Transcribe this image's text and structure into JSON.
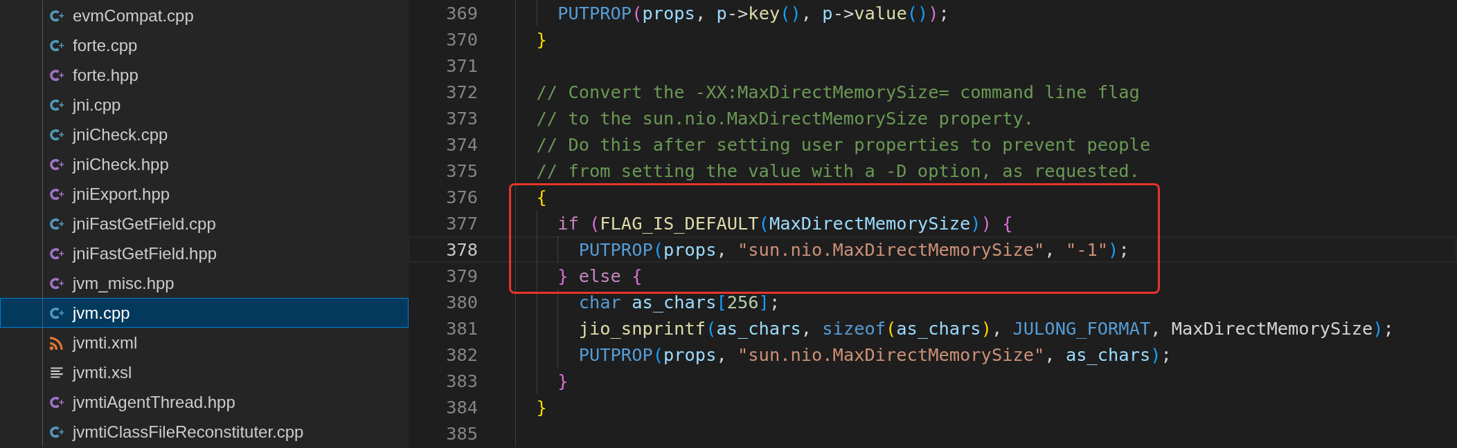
{
  "sidebar": {
    "files": [
      {
        "name": "evmCompat.cpp",
        "kind": "cpp",
        "selected": false
      },
      {
        "name": "forte.cpp",
        "kind": "cpp",
        "selected": false
      },
      {
        "name": "forte.hpp",
        "kind": "hpp",
        "selected": false
      },
      {
        "name": "jni.cpp",
        "kind": "cpp",
        "selected": false
      },
      {
        "name": "jniCheck.cpp",
        "kind": "cpp",
        "selected": false
      },
      {
        "name": "jniCheck.hpp",
        "kind": "hpp",
        "selected": false
      },
      {
        "name": "jniExport.hpp",
        "kind": "hpp",
        "selected": false
      },
      {
        "name": "jniFastGetField.cpp",
        "kind": "cpp",
        "selected": false
      },
      {
        "name": "jniFastGetField.hpp",
        "kind": "hpp",
        "selected": false
      },
      {
        "name": "jvm_misc.hpp",
        "kind": "hpp",
        "selected": false
      },
      {
        "name": "jvm.cpp",
        "kind": "cpp",
        "selected": true
      },
      {
        "name": "jvmti.xml",
        "kind": "xml",
        "selected": false
      },
      {
        "name": "jvmti.xsl",
        "kind": "text",
        "selected": false
      },
      {
        "name": "jvmtiAgentThread.hpp",
        "kind": "hpp",
        "selected": false
      },
      {
        "name": "jvmtiClassFileReconstituter.cpp",
        "kind": "cpp",
        "selected": false
      }
    ]
  },
  "editor": {
    "lines": [
      {
        "number": "369",
        "current": false,
        "tokens": [
          {
            "kind": "macro",
            "text": "    PUTPROP"
          },
          {
            "kind": "bracket2",
            "text": "("
          },
          {
            "kind": "var",
            "text": "props"
          },
          {
            "kind": "plain",
            "text": ", "
          },
          {
            "kind": "var",
            "text": "p"
          },
          {
            "kind": "plain",
            "text": "->"
          },
          {
            "kind": "func",
            "text": "key"
          },
          {
            "kind": "bracket3",
            "text": "()"
          },
          {
            "kind": "plain",
            "text": ", "
          },
          {
            "kind": "var",
            "text": "p"
          },
          {
            "kind": "plain",
            "text": "->"
          },
          {
            "kind": "func",
            "text": "value"
          },
          {
            "kind": "bracket3",
            "text": "()"
          },
          {
            "kind": "bracket2",
            "text": ")"
          },
          {
            "kind": "plain",
            "text": ";"
          }
        ]
      },
      {
        "number": "370",
        "current": false,
        "tokens": [
          {
            "kind": "bracket1",
            "text": "  }"
          }
        ]
      },
      {
        "number": "371",
        "current": false
      },
      {
        "number": "372",
        "current": false,
        "tokens": [
          {
            "kind": "comment",
            "text": "  // Convert the -XX:MaxDirectMemorySize= command line flag"
          }
        ]
      },
      {
        "number": "373",
        "current": false,
        "tokens": [
          {
            "kind": "comment",
            "text": "  // to the sun.nio.MaxDirectMemorySize property."
          }
        ]
      },
      {
        "number": "374",
        "current": false,
        "tokens": [
          {
            "kind": "comment",
            "text": "  // Do this after setting user properties to prevent people"
          }
        ]
      },
      {
        "number": "375",
        "current": false,
        "tokens": [
          {
            "kind": "comment",
            "text": "  // from setting the value with a -D option, as requested."
          }
        ]
      },
      {
        "number": "376",
        "current": false,
        "tokens": [
          {
            "kind": "bracket1",
            "text": "  {"
          }
        ]
      },
      {
        "number": "377",
        "current": false,
        "tokens": [
          {
            "kind": "keyword",
            "text": "    if "
          },
          {
            "kind": "bracket2",
            "text": "("
          },
          {
            "kind": "func",
            "text": "FLAG_IS_DEFAULT"
          },
          {
            "kind": "bracket3",
            "text": "("
          },
          {
            "kind": "var",
            "text": "MaxDirectMemorySize"
          },
          {
            "kind": "bracket3",
            "text": ")"
          },
          {
            "kind": "bracket2",
            "text": ") {"
          }
        ]
      },
      {
        "number": "378",
        "current": true,
        "tokens": [
          {
            "kind": "macro",
            "text": "      PUTPROP"
          },
          {
            "kind": "bracket3",
            "text": "("
          },
          {
            "kind": "var",
            "text": "props"
          },
          {
            "kind": "plain",
            "text": ", "
          },
          {
            "kind": "string",
            "text": "\"sun.nio.MaxDirectMemorySize\""
          },
          {
            "kind": "plain",
            "text": ", "
          },
          {
            "kind": "string",
            "text": "\"-1\""
          },
          {
            "kind": "bracket3",
            "text": ")"
          },
          {
            "kind": "plain",
            "text": ";"
          }
        ]
      },
      {
        "number": "379",
        "current": false,
        "tokens": [
          {
            "kind": "bracket2",
            "text": "    } "
          },
          {
            "kind": "keyword",
            "text": "else "
          },
          {
            "kind": "bracket2",
            "text": "{"
          }
        ]
      },
      {
        "number": "380",
        "current": false,
        "tokens": [
          {
            "kind": "type",
            "text": "      char "
          },
          {
            "kind": "var",
            "text": "as_chars"
          },
          {
            "kind": "bracket3",
            "text": "["
          },
          {
            "kind": "number",
            "text": "256"
          },
          {
            "kind": "bracket3",
            "text": "]"
          },
          {
            "kind": "plain",
            "text": ";"
          }
        ]
      },
      {
        "number": "381",
        "current": false,
        "tokens": [
          {
            "kind": "func",
            "text": "      jio_snprintf"
          },
          {
            "kind": "bracket3",
            "text": "("
          },
          {
            "kind": "var",
            "text": "as_chars"
          },
          {
            "kind": "plain",
            "text": ", "
          },
          {
            "kind": "type",
            "text": "sizeof"
          },
          {
            "kind": "bracket1",
            "text": "("
          },
          {
            "kind": "var",
            "text": "as_chars"
          },
          {
            "kind": "bracket1",
            "text": ")"
          },
          {
            "kind": "plain",
            "text": ", "
          },
          {
            "kind": "macro",
            "text": "JULONG_FORMAT"
          },
          {
            "kind": "plain",
            "text": ", MaxDirectMemorySize"
          },
          {
            "kind": "bracket3",
            "text": ")"
          },
          {
            "kind": "plain",
            "text": ";"
          }
        ]
      },
      {
        "number": "382",
        "current": false,
        "tokens": [
          {
            "kind": "macro",
            "text": "      PUTPROP"
          },
          {
            "kind": "bracket3",
            "text": "("
          },
          {
            "kind": "var",
            "text": "props"
          },
          {
            "kind": "plain",
            "text": ", "
          },
          {
            "kind": "string",
            "text": "\"sun.nio.MaxDirectMemorySize\""
          },
          {
            "kind": "plain",
            "text": ", "
          },
          {
            "kind": "var",
            "text": "as_chars"
          },
          {
            "kind": "bracket3",
            "text": ")"
          },
          {
            "kind": "plain",
            "text": ";"
          }
        ]
      },
      {
        "number": "383",
        "current": false,
        "tokens": [
          {
            "kind": "bracket2",
            "text": "    }"
          }
        ]
      },
      {
        "number": "384",
        "current": false,
        "tokens": [
          {
            "kind": "bracket1",
            "text": "  }"
          }
        ]
      },
      {
        "number": "385",
        "current": false
      }
    ]
  }
}
